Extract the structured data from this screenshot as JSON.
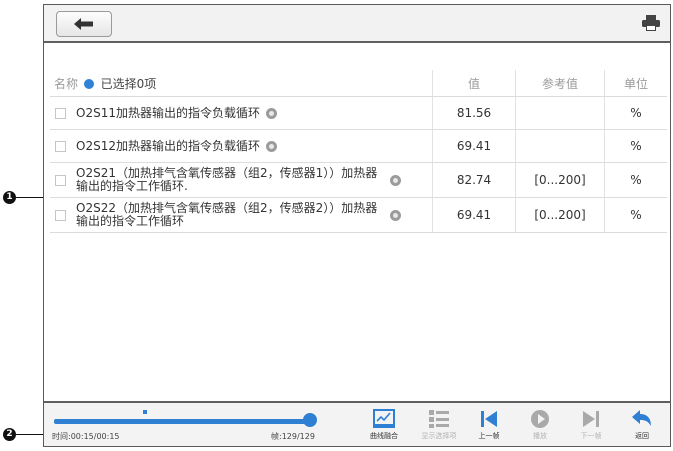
{
  "markers": {
    "m1": "1",
    "m2": "2"
  },
  "table": {
    "header": {
      "name": "名称",
      "selected": "已选择0项",
      "value": "值",
      "reference": "参考值",
      "unit": "单位"
    },
    "rows": [
      {
        "name": "O2S11加热器输出的指令负载循环",
        "value": "81.56",
        "reference": "",
        "unit": "%"
      },
      {
        "name": "O2S12加热器输出的指令负载循环",
        "value": "69.41",
        "reference": "",
        "unit": "%"
      },
      {
        "name": "O2S21（加热排气含氧传感器（组2，传感器1））加热器输出的指令工作循环.",
        "value": "82.74",
        "reference": "[0...200]",
        "unit": "%"
      },
      {
        "name": "O2S22（加热排气含氧传感器（组2，传感器2））加热器输出的指令工作循环",
        "value": "69.41",
        "reference": "[0...200]",
        "unit": "%"
      }
    ]
  },
  "playback": {
    "time": "时间:00:15/00:15",
    "frame": "帧:129/129",
    "progress": 1.0,
    "controls": [
      {
        "label": "曲线融合",
        "icon": "chart-icon",
        "enabled": true
      },
      {
        "label": "显示选择项",
        "icon": "list-icon",
        "enabled": false
      },
      {
        "label": "上一帧",
        "icon": "previous-frame-icon",
        "enabled": true
      },
      {
        "label": "播放",
        "icon": "play-icon",
        "enabled": false
      },
      {
        "label": "下一帧",
        "icon": "next-frame-icon",
        "enabled": false
      },
      {
        "label": "返回",
        "icon": "return-icon",
        "enabled": true
      }
    ]
  },
  "colors": {
    "accent": "#2f7fd3",
    "border": "#5f5f5f"
  }
}
